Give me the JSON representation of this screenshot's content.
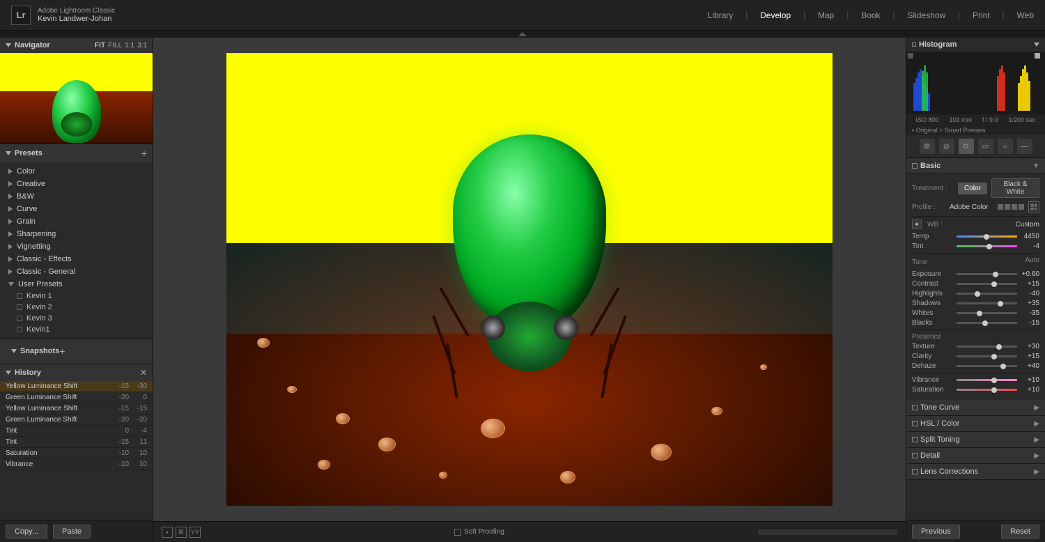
{
  "app": {
    "name": "Adobe Lightroom Classic",
    "user": "Kevin Landwer-Johan"
  },
  "nav": {
    "items": [
      "Library",
      "Develop",
      "Map",
      "Book",
      "Slideshow",
      "Print",
      "Web"
    ],
    "active": "Develop"
  },
  "navigator": {
    "title": "Navigator",
    "zoom_options": [
      "FIT",
      "FILL",
      "1:1",
      "3:1"
    ]
  },
  "presets": {
    "title": "Presets",
    "add_btn": "+",
    "categories": [
      {
        "name": "Color",
        "open": false
      },
      {
        "name": "Creative",
        "open": false
      },
      {
        "name": "B&W",
        "open": false
      },
      {
        "name": "Curve",
        "open": false
      },
      {
        "name": "Grain",
        "open": false
      },
      {
        "name": "Sharpening",
        "open": false
      },
      {
        "name": "Vignetting",
        "open": false
      },
      {
        "name": "Classic - Effects",
        "open": false
      },
      {
        "name": "Classic - General",
        "open": false
      }
    ],
    "user_presets": {
      "label": "User Presets",
      "items": [
        "Kevin 1",
        "Kevin 2",
        "Kevin 3",
        "Kevin1"
      ]
    }
  },
  "snapshots": {
    "title": "Snapshots",
    "add_btn": "+"
  },
  "history": {
    "title": "History",
    "items": [
      {
        "name": "Yellow Luminance Shift",
        "val1": "-15",
        "val2": "-30"
      },
      {
        "name": "Green Luminance Shift",
        "val1": "-20",
        "val2": "0"
      },
      {
        "name": "Yellow Luminance Shift",
        "val1": "-15",
        "val2": "-15"
      },
      {
        "name": "Green Luminance Shift",
        "val1": "-20",
        "val2": "-20"
      },
      {
        "name": "Tint",
        "val1": "0",
        "val2": "-4"
      },
      {
        "name": "Tint",
        "val1": "-15",
        "val2": "11"
      },
      {
        "name": "Saturation",
        "val1": "-10",
        "val2": "10"
      },
      {
        "name": "Vibrance",
        "val1": "-10",
        "val2": "10"
      }
    ]
  },
  "bottom_left": {
    "copy_label": "Copy...",
    "paste_label": "Paste"
  },
  "toolbar": {
    "soft_proofing_label": "Soft Proofing",
    "yy_label": "YY"
  },
  "histogram": {
    "title": "Histogram",
    "exif": {
      "iso": "ISO 800",
      "focal": "103 mm",
      "aperture": "f / 9.0",
      "shutter": "1/200 sec"
    },
    "smart_preview": "Original + Smart Preview"
  },
  "basic": {
    "title": "Basic",
    "treatment_label": "Treatment :",
    "color_btn": "Color",
    "bw_btn": "Black & White",
    "profile_label": "Profile :",
    "profile_value": "Adobe Color",
    "wb_label": "WB :",
    "wb_value": "Custom",
    "temp_label": "Temp",
    "temp_value": "4450",
    "tint_label": "Tint",
    "tint_value": "-4",
    "tone_label": "Tone",
    "auto_label": "Auto",
    "exposure_label": "Exposure",
    "exposure_value": "+0.60",
    "contrast_label": "Contrast",
    "contrast_value": "+15",
    "highlights_label": "Highlights",
    "highlights_value": "-40",
    "shadows_label": "Shadows",
    "shadows_value": "+35",
    "whites_label": "Whites",
    "whites_value": "-35",
    "blacks_label": "Blacks",
    "blacks_value": "-15",
    "presence_label": "Presence",
    "texture_label": "Texture",
    "texture_value": "+30",
    "clarity_label": "Clarity",
    "clarity_value": "+15",
    "dehaze_label": "Dehaze",
    "dehaze_value": "+40",
    "vibrance_label": "Vibrance",
    "vibrance_value": "+10",
    "saturation_label": "Saturation",
    "saturation_value": "+10"
  },
  "collapsed_sections": [
    {
      "name": "Tone Curve"
    },
    {
      "name": "HSL / Color"
    },
    {
      "name": "Split Toning"
    },
    {
      "name": "Detail"
    },
    {
      "name": "Lens Corrections"
    }
  ],
  "bottom_right": {
    "previous_label": "Previous",
    "reset_label": "Reset"
  },
  "classic_preset": "Classic -"
}
